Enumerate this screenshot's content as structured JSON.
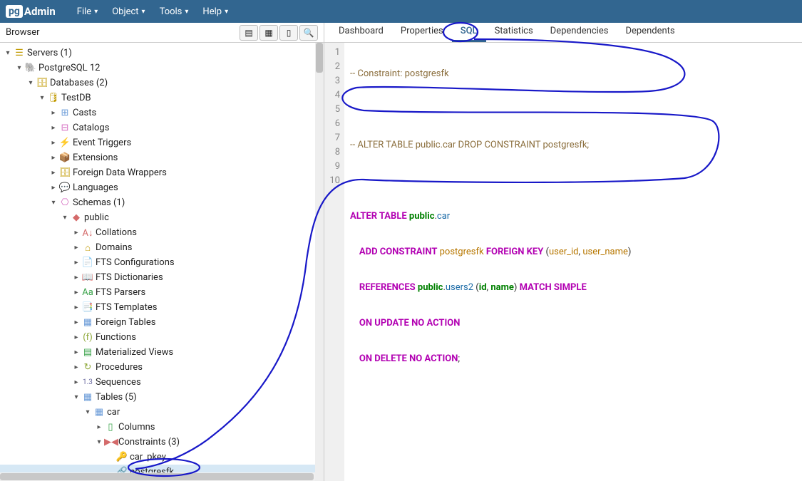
{
  "topbar": {
    "logo_prefix": "pg",
    "logo_suffix": "Admin",
    "menus": [
      "File",
      "Object",
      "Tools",
      "Help"
    ]
  },
  "browser": {
    "title": "Browser"
  },
  "tree": {
    "servers": "Servers (1)",
    "pg12": "PostgreSQL 12",
    "databases": "Databases (2)",
    "testdb": "TestDB",
    "casts": "Casts",
    "catalogs": "Catalogs",
    "event_triggers": "Event Triggers",
    "extensions": "Extensions",
    "fdw": "Foreign Data Wrappers",
    "languages": "Languages",
    "schemas": "Schemas (1)",
    "public": "public",
    "collations": "Collations",
    "domains": "Domains",
    "fts_conf": "FTS Configurations",
    "fts_dict": "FTS Dictionaries",
    "fts_parsers": "FTS Parsers",
    "fts_templates": "FTS Templates",
    "foreign_tables": "Foreign Tables",
    "functions": "Functions",
    "mat_views": "Materialized Views",
    "procedures": "Procedures",
    "sequences": "Sequences",
    "tables": "Tables (5)",
    "car": "car",
    "columns": "Columns",
    "constraints": "Constraints (3)",
    "car_pkey": "car_pkey",
    "postgresfk": "postgresfk"
  },
  "tabs": [
    "Dashboard",
    "Properties",
    "SQL",
    "Statistics",
    "Dependencies",
    "Dependents"
  ],
  "active_tab_index": 2,
  "code": {
    "l1": "-- Constraint: postgresfk",
    "l2": "",
    "l3": "-- ALTER TABLE public.car DROP CONSTRAINT postgresfk;",
    "l4": "",
    "l5a": "ALTER TABLE",
    "l5b": "public",
    "l5c": "car",
    "l6a": "ADD CONSTRAINT",
    "l6b": "postgresfk",
    "l6c": "FOREIGN KEY",
    "l6d": "user_id",
    "l6e": "user_name",
    "l7a": "REFERENCES",
    "l7b": "public",
    "l7c": "users2",
    "l7d": "id",
    "l7e": "name",
    "l7f": "MATCH SIMPLE",
    "l8a": "ON UPDATE",
    "l8b": "NO ACTION",
    "l9a": "ON DELETE",
    "l9b": "NO ACTION"
  },
  "line_numbers": [
    "1",
    "2",
    "3",
    "4",
    "5",
    "6",
    "7",
    "8",
    "9",
    "10"
  ]
}
